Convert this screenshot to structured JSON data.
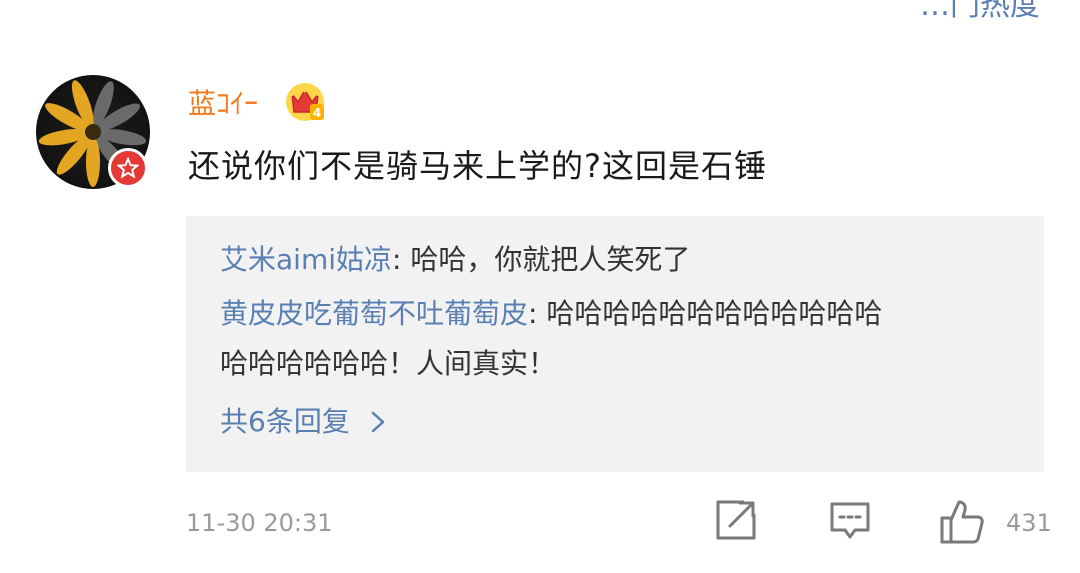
{
  "header": {
    "partial_text": "…门热度"
  },
  "comment": {
    "username": "蓝ｺｲｰ",
    "badge_level": "4",
    "text": "还说你们不是骑马来上学的?这回是石锤",
    "timestamp": "11-30 20:31",
    "like_count": "431"
  },
  "replies": [
    {
      "name": "艾米aimi姑凉",
      "separator": ": ",
      "text": "哈哈，你就把人笑死了"
    },
    {
      "name": "黄皮皮吃葡萄不吐葡萄皮",
      "separator": ": ",
      "text": "哈哈哈哈哈哈哈哈哈哈哈哈",
      "text2": "哈哈哈哈哈哈！人间真实！"
    }
  ],
  "more_replies_label": "共6条回复",
  "icons": {
    "share": "share-icon",
    "comment": "comment-icon",
    "like": "like-icon",
    "chevron": "chevron-right-icon",
    "crown": "crown-icon",
    "verified": "verified-star-icon"
  },
  "colors": {
    "username": "#f07c1e",
    "link_blue": "#5a7fb2",
    "reply_bg": "#f2f2f2",
    "meta_gray": "#9a9a9a",
    "badge_red": "#e53935"
  }
}
